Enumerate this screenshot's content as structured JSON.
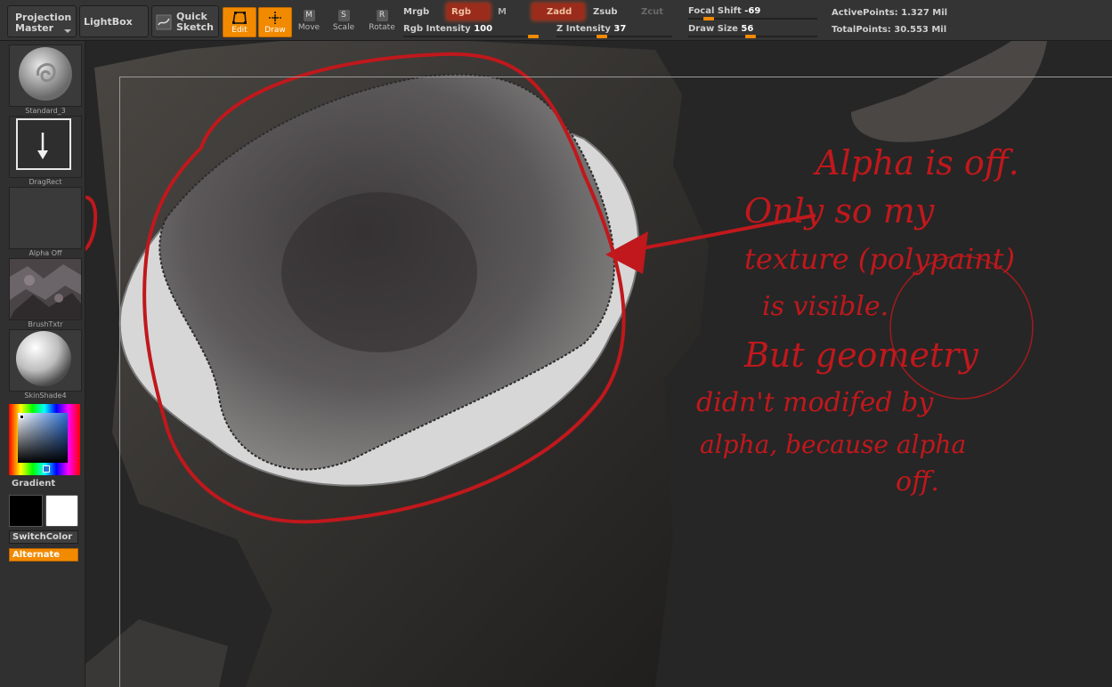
{
  "toolbar": {
    "projection_master": [
      "Projection",
      "Master"
    ],
    "lightbox": "LightBox",
    "quick_sketch": [
      "Quick",
      "Sketch"
    ],
    "tools": {
      "edit": "Edit",
      "draw": "Draw",
      "move": "Move",
      "scale": "Scale",
      "rotate": "Rotate"
    },
    "keys": {
      "move": "M",
      "scale": "S",
      "rotate": "R"
    },
    "mrgb": "Mrgb",
    "rgb": "Rgb",
    "m": "M",
    "zadd": "Zadd",
    "zsub": "Zsub",
    "zcut": "Zcut",
    "rgb_intensity": {
      "label": "Rgb Intensity",
      "value": "100",
      "fraction": 1.0
    },
    "z_intensity": {
      "label": "Z Intensity",
      "value": "37",
      "fraction": 0.37
    },
    "focal_shift": {
      "label": "Focal Shift",
      "value": "-69",
      "fraction": 0.15
    },
    "draw_size": {
      "label": "Draw Size",
      "value": "56",
      "fraction": 0.05
    },
    "active_points": {
      "label": "ActivePoints:",
      "value": "1.327 Mil"
    },
    "total_points": {
      "label": "TotalPoints:",
      "value": "30.553 Mil"
    }
  },
  "shelf": {
    "brush": "Standard_3",
    "stroke": "DragRect",
    "alpha": "Alpha Off",
    "texture": "BrushTxtr",
    "material": "SkinShade4",
    "gradient": "Gradient",
    "switch_color": "SwitchColor",
    "alternate": "Alternate"
  },
  "annotation": {
    "lines": [
      "Alpha is off.",
      "Only so my",
      "texture (polypaint)",
      "is visible.",
      "But geometry",
      "didn't modifed by",
      "alpha, because alpha",
      "off."
    ]
  },
  "colors": {
    "accent": "#f28a00",
    "highlight": "#e0301a",
    "ink": "#c0181c"
  },
  "icons": [
    "edit-icon",
    "draw-icon",
    "move-icon",
    "scale-icon",
    "rotate-icon",
    "quick-sketch-icon",
    "arrow-down-icon"
  ]
}
